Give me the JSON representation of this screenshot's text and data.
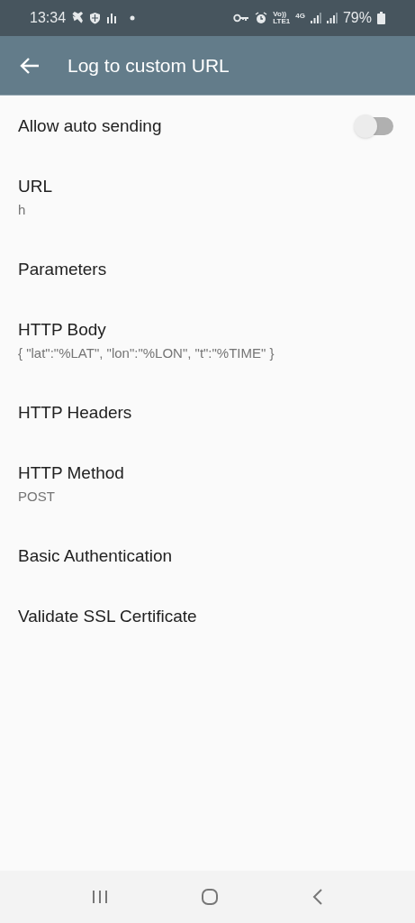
{
  "status_bar": {
    "time": "13:34",
    "volte": "Vo))",
    "lte": "LTE1",
    "network": "4G",
    "battery": "79%"
  },
  "app_bar": {
    "title": "Log to custom URL"
  },
  "settings": [
    {
      "kind": "switch",
      "title": "Allow auto sending",
      "on": false
    },
    {
      "kind": "text",
      "title": "URL",
      "summary": "h"
    },
    {
      "kind": "text",
      "title": "Parameters"
    },
    {
      "kind": "text",
      "title": "HTTP Body",
      "summary": "{ \"lat\":\"%LAT\", \"lon\":\"%LON\", \"t\":\"%TIME\" }"
    },
    {
      "kind": "text",
      "title": "HTTP Headers"
    },
    {
      "kind": "text",
      "title": "HTTP Method",
      "summary": "POST"
    },
    {
      "kind": "text",
      "title": "Basic Authentication"
    },
    {
      "kind": "text",
      "title": "Validate SSL Certificate"
    }
  ]
}
